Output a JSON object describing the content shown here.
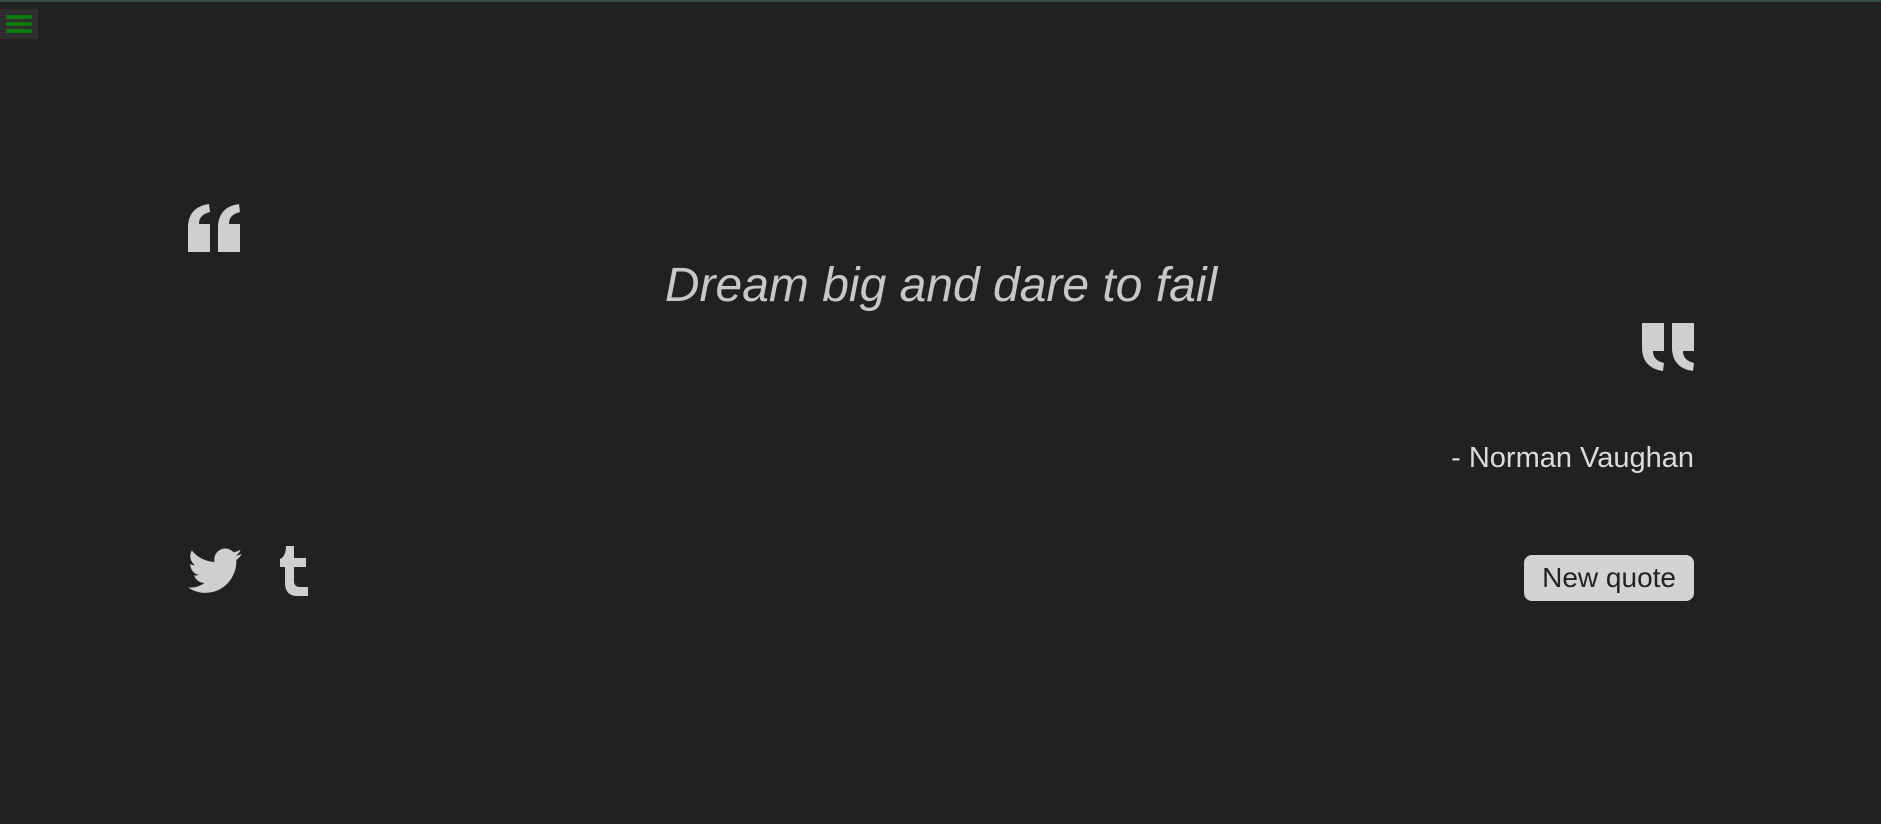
{
  "menu": {
    "icon": "hamburger-menu-icon",
    "color": "#0c7a0c"
  },
  "quote": {
    "open_icon": "quote-left-icon",
    "close_icon": "quote-right-icon",
    "text": "Dream big and dare to fail",
    "author": "- Norman Vaughan"
  },
  "share": {
    "twitter_icon": "twitter-icon",
    "tumblr_icon": "tumblr-icon"
  },
  "actions": {
    "new_quote_label": "New quote"
  },
  "colors": {
    "background": "#212121",
    "text": "#c8c8c8",
    "icons": "#cfcfcf",
    "button": "#d3d3d3"
  }
}
